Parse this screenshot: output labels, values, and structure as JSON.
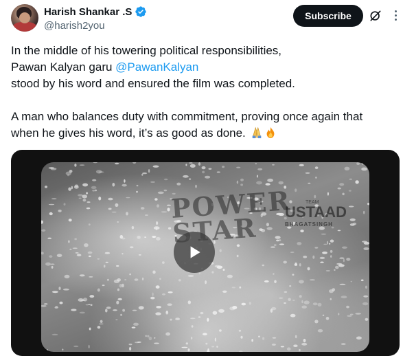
{
  "author": {
    "name": "Harish Shankar .S",
    "handle": "@harish2you",
    "verified_color": "#1d9bf0"
  },
  "header": {
    "subscribe_label": "Subscribe",
    "grok_icon": "grok-icon",
    "more_icon": "more-icon"
  },
  "tweet": {
    "line1": "In the middle of his towering political responsibilities,",
    "line2_prefix": "Pawan Kalyan garu ",
    "mention": "@PawanKalyan",
    "line3": "stood by his word and ensured the film was completed.",
    "line4": "A man who balances duty with commitment, proving once again that",
    "line5": "when he gives his word, it’s as good as done.",
    "emojis": [
      "folded-hands-icon",
      "fire-icon"
    ]
  },
  "media": {
    "overlay_text_left": "POWER STAR",
    "overlay_text_team": "TEAM",
    "overlay_text_right": "USTAAD",
    "overlay_text_right_sub": "BHAGATSINGH",
    "play_icon": "play-icon"
  },
  "colors": {
    "text": "#0f1419",
    "secondary": "#536471",
    "link": "#1d9bf0",
    "button_bg": "#0f1419"
  }
}
